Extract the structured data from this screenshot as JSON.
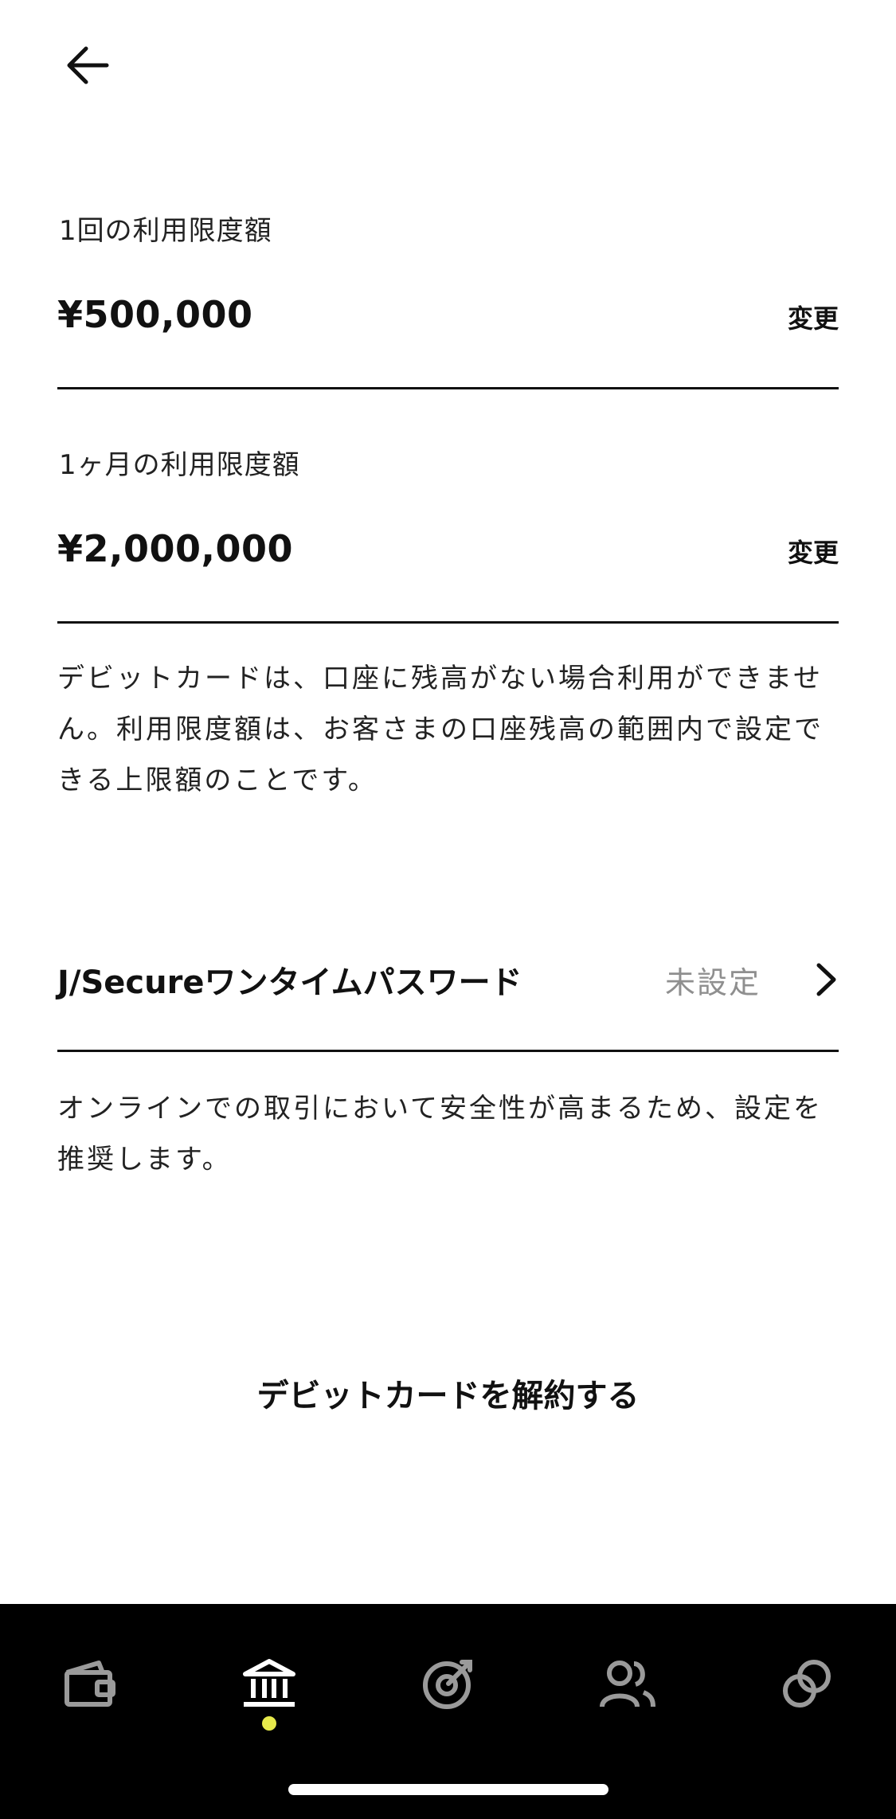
{
  "header": {
    "back_icon": "arrow-left-icon"
  },
  "limits": {
    "per_use": {
      "label": "1回の利用限度額",
      "amount": "¥500,000",
      "change_label": "変更"
    },
    "per_month": {
      "label": "1ヶ月の利用限度額",
      "amount": "¥2,000,000",
      "change_label": "変更"
    },
    "note": "デビットカードは、口座に残高がない場合利用ができません。利用限度額は、お客さまの口座残高の範囲内で設定できる上限額のことです。"
  },
  "jsecure": {
    "title": "J/Secureワンタイムパスワード",
    "status": "未設定",
    "note": "オンラインでの取引において安全性が高まるため、設定を推奨します。"
  },
  "cancel": {
    "label": "デビットカードを解約する"
  },
  "tabbar": {
    "items": [
      {
        "icon": "wallet-icon",
        "active": false
      },
      {
        "icon": "bank-icon",
        "active": true
      },
      {
        "icon": "target-icon",
        "active": false
      },
      {
        "icon": "people-icon",
        "active": false
      },
      {
        "icon": "link-icon",
        "active": false
      }
    ],
    "active_dot_color": "#e6e94b",
    "icon_color": "#9a9a9a",
    "active_icon_color": "#ffffff"
  }
}
